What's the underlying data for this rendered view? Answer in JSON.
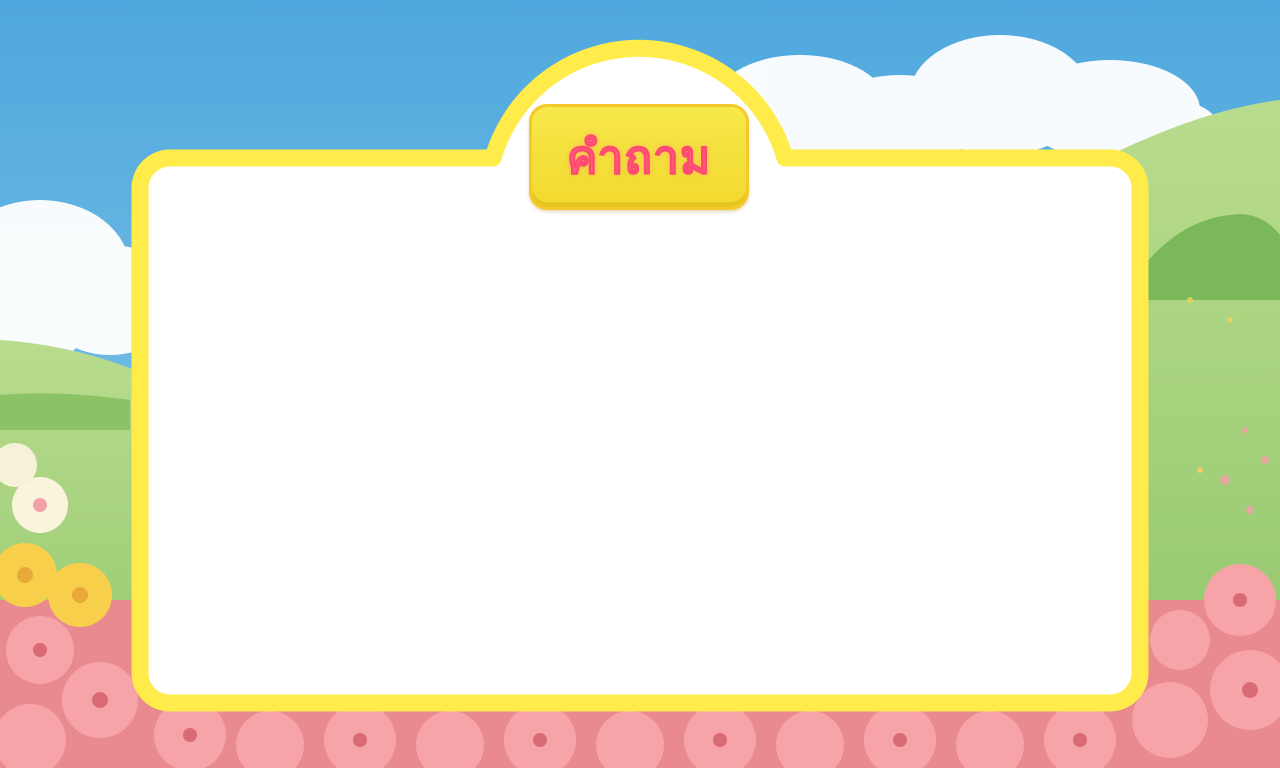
{
  "title": "คำถาม",
  "colors": {
    "sky": "#5eb2e2",
    "cloud": "#ffffff",
    "hill_green": "#a9d47f",
    "frame_yellow": "#ffeb4a",
    "card_white": "#ffffff",
    "badge_yellow": "#f4de3a",
    "title_pink": "#ff5f7e",
    "flower_pink": "#f58f96",
    "flower_yellow": "#f7cf4a"
  },
  "icons": [
    "cloud-icon",
    "flower-icon"
  ]
}
